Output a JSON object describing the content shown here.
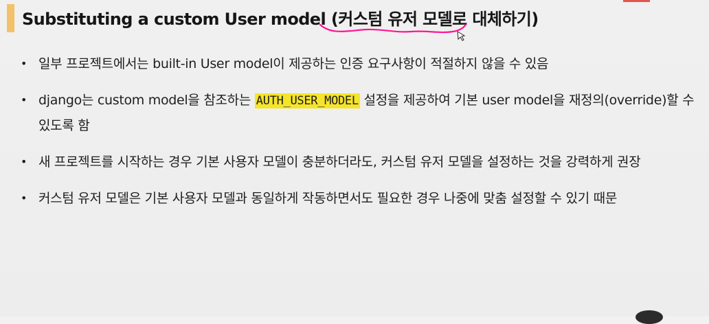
{
  "slide": {
    "title": "Substituting a custom User model (커스텀 유저 모델로 대체하기)",
    "accent_color": "#f2c26b",
    "highlight_color": "#f5e52a",
    "annotation_color": "#ff1493",
    "bullets": [
      {
        "before": "일부 프로젝트에서는 built-in User model이 제공하는 인증 요구사항이 적절하지 않을 수 있음",
        "code": "",
        "after": ""
      },
      {
        "before": "django는 custom model을 참조하는 ",
        "code": "AUTH_USER_MODEL",
        "after": "  설정을 제공하여 기본 user model을 재정의(override)할 수 있도록 함"
      },
      {
        "before": "새 프로젝트를 시작하는 경우 기본 사용자 모델이 충분하더라도, 커스텀 유저 모델을 설정하는 것을 강력하게 권장",
        "code": "",
        "after": ""
      },
      {
        "before": "커스텀 유저 모델은 기본 사용자 모델과 동일하게 작동하면서도 필요한 경우 나중에 맞춤 설정할 수 있기 때문",
        "code": "",
        "after": ""
      }
    ],
    "bullet_glyph": "•"
  }
}
